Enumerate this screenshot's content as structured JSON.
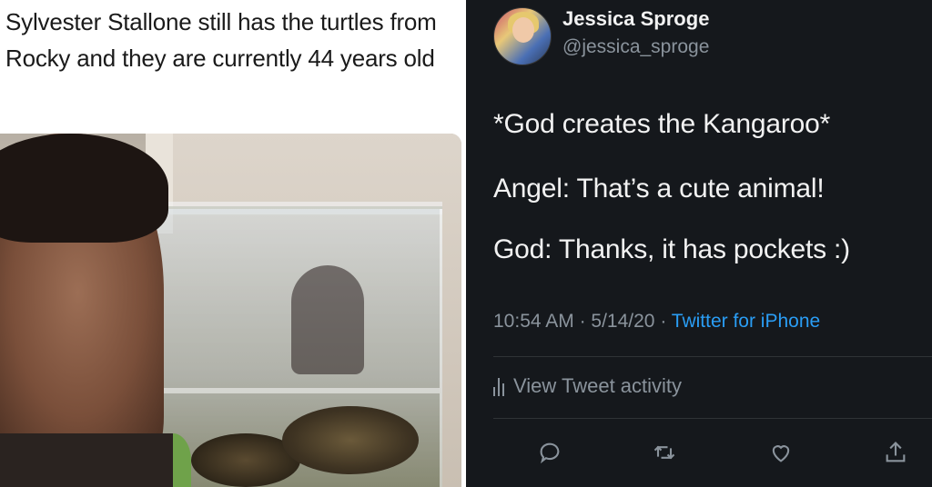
{
  "left_post": {
    "caption": "Sylvester Stallone still has the turtles from Rocky and they are currently 44 years old"
  },
  "tweet": {
    "display_name": "Jessica Sproge",
    "handle": "@jessica_sproge",
    "lines": [
      "*God creates the Kangaroo*",
      "Angel: That’s a cute animal!",
      "God: Thanks, it has pockets :)"
    ],
    "time": "10:54 AM",
    "date": "5/14/20",
    "source": "Twitter for iPhone",
    "activity_label": "View Tweet activity",
    "icons": {
      "reply": "reply-icon",
      "retweet": "retweet-icon",
      "like": "heart-icon",
      "share": "share-icon"
    },
    "colors": {
      "background": "#15181c",
      "link": "#2a9df4",
      "muted": "#8a939c",
      "text": "#f2f2f2"
    }
  }
}
